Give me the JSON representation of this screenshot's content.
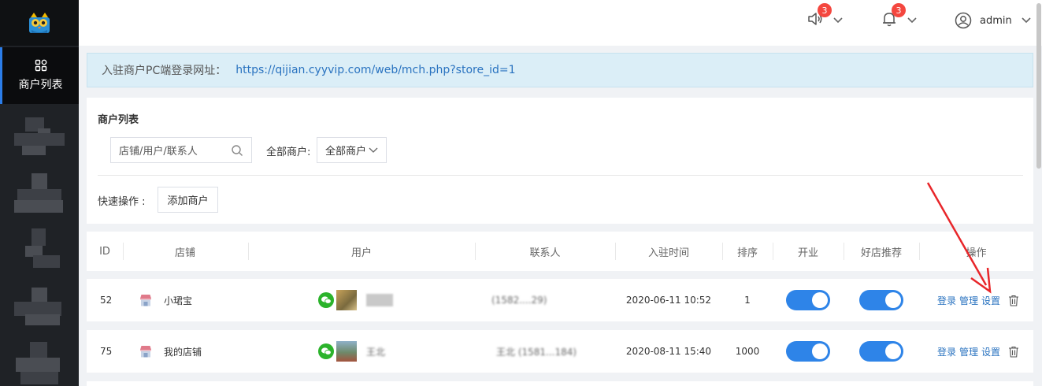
{
  "sidebar": {
    "logo": "app-logo",
    "active_item": {
      "label": "商户列表",
      "icon": "grid-icon"
    }
  },
  "header": {
    "notice_badge": "3",
    "bell_badge": "3",
    "user": "admin"
  },
  "notice": {
    "label": "入驻商户PC端登录网址：",
    "url": "https://qijian.cyyvip.com/web/mch.php?store_id=1"
  },
  "filter": {
    "title": "商户列表",
    "search_placeholder": "店铺/用户/联系人",
    "type_label": "全部商户:",
    "type_value": "全部商户",
    "quick_label": "快速操作 :",
    "add_button": "添加商户"
  },
  "table": {
    "columns": [
      "ID",
      "店铺",
      "用户",
      "联系人",
      "入驻时间",
      "排序",
      "开业",
      "好店推荐",
      "操作"
    ],
    "rows": [
      {
        "id": "52",
        "store": "小珺宝",
        "user": "",
        "contact": "(1582....29)",
        "time": "2020-06-11 10:52",
        "sort": "1",
        "open": true,
        "recommend": true
      },
      {
        "id": "75",
        "store": "我的店铺",
        "user": "王北",
        "contact": "王北 (1581...184)",
        "time": "2020-08-11 15:40",
        "sort": "1000",
        "open": true,
        "recommend": true
      }
    ],
    "actions": {
      "login": "登录",
      "manage": "管理",
      "settings": "设置"
    }
  },
  "colors": {
    "accent": "#2e84e8",
    "link": "#2a73c0",
    "badge": "#f4473f",
    "sidebar": "#1f2226"
  }
}
